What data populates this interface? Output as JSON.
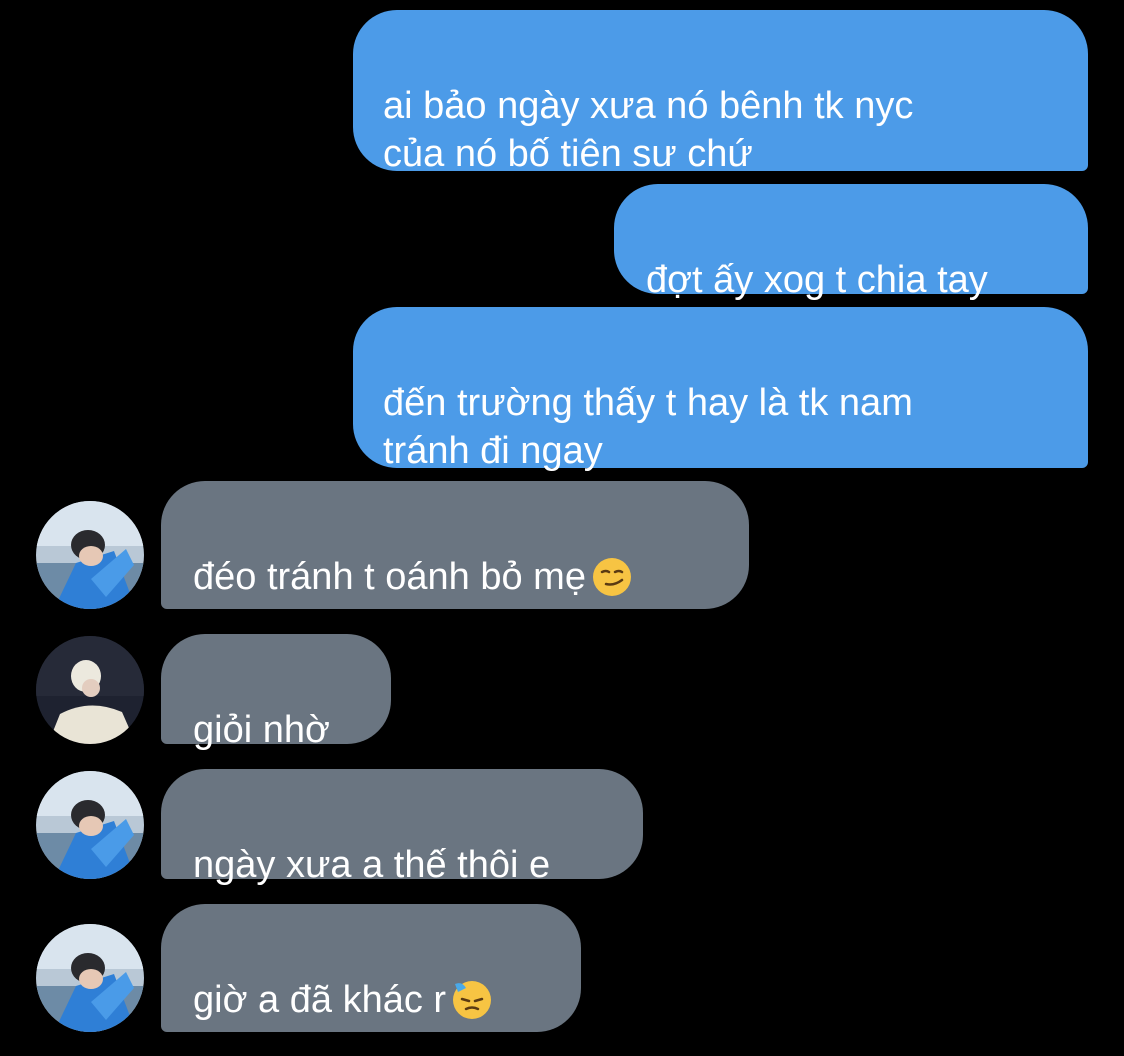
{
  "messages": {
    "m1": "ai bảo ngày xưa nó bênh tk nyc\ncủa nó bố tiên sư chứ",
    "m2": "đợt ấy xog t chia tay",
    "m3": "đến trường thấy t hay là tk nam\ntránh đi ngay",
    "m4": "đéo tránh t oánh bỏ mẹ",
    "m5": "giỏi nhờ",
    "m6": "ngày xưa a thế thôi e",
    "m7": "giờ a đã khác r"
  },
  "emojis": {
    "m4": "smirking-face",
    "m7": "downcast-face-with-sweat"
  },
  "colors": {
    "background": "#000000",
    "sent_bubble": "#4c9be8",
    "received_bubble": "#6a7581",
    "text": "#ffffff"
  }
}
